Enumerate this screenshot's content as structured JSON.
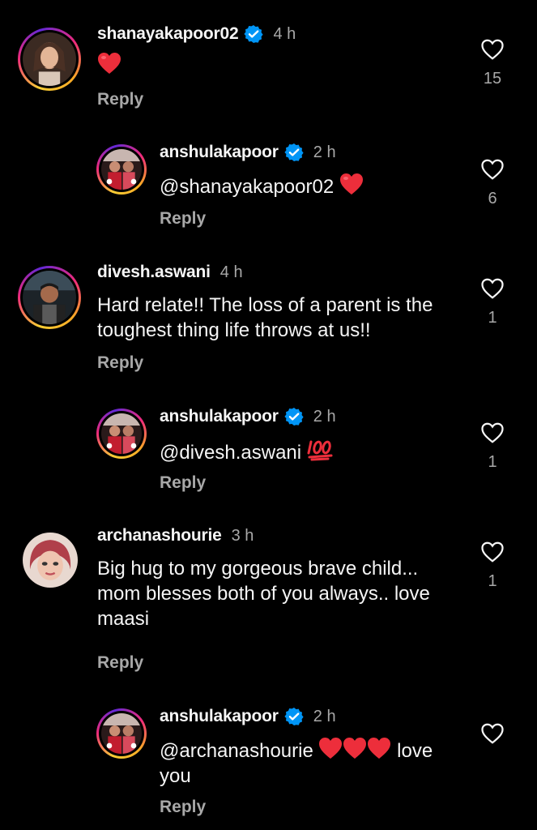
{
  "comments": [
    {
      "username": "shanayakapoor02",
      "verified": true,
      "time": "4 h",
      "text": "",
      "emoji": "heart",
      "reply_label": "Reply",
      "likes": "15"
    },
    {
      "username": "anshulakapoor",
      "verified": true,
      "time": "2 h",
      "mention": "@shanayakapoor02",
      "text": "",
      "emoji": "heart",
      "reply_label": "Reply",
      "likes": "6"
    },
    {
      "username": "divesh.aswani",
      "verified": false,
      "time": "4 h",
      "text": "Hard relate!! The loss of a parent is the toughest thing life throws at us!!",
      "reply_label": "Reply",
      "likes": "1"
    },
    {
      "username": "anshulakapoor",
      "verified": true,
      "time": "2 h",
      "mention": "@divesh.aswani",
      "emoji": "100",
      "reply_label": "Reply",
      "likes": "1"
    },
    {
      "username": "archanashourie",
      "verified": false,
      "time": "3 h",
      "text": "Big hug to my gorgeous brave child... mom blesses both of you always.. love maasi",
      "reply_label": "Reply",
      "likes": "1"
    },
    {
      "username": "anshulakapoor",
      "verified": true,
      "time": "2 h",
      "mention": "@archanashourie",
      "emoji": "three-hearts",
      "text_after": "love you",
      "reply_label": "Reply",
      "likes": ""
    }
  ],
  "colors": {
    "background": "#000000",
    "primary_text": "#f5f5f5",
    "secondary_text": "#a8a8a8",
    "verified_blue": "#0095f6",
    "heart_red": "#ed2e3b"
  },
  "icons": {
    "like": "heart-outline-icon",
    "verified": "verified-badge-icon"
  }
}
